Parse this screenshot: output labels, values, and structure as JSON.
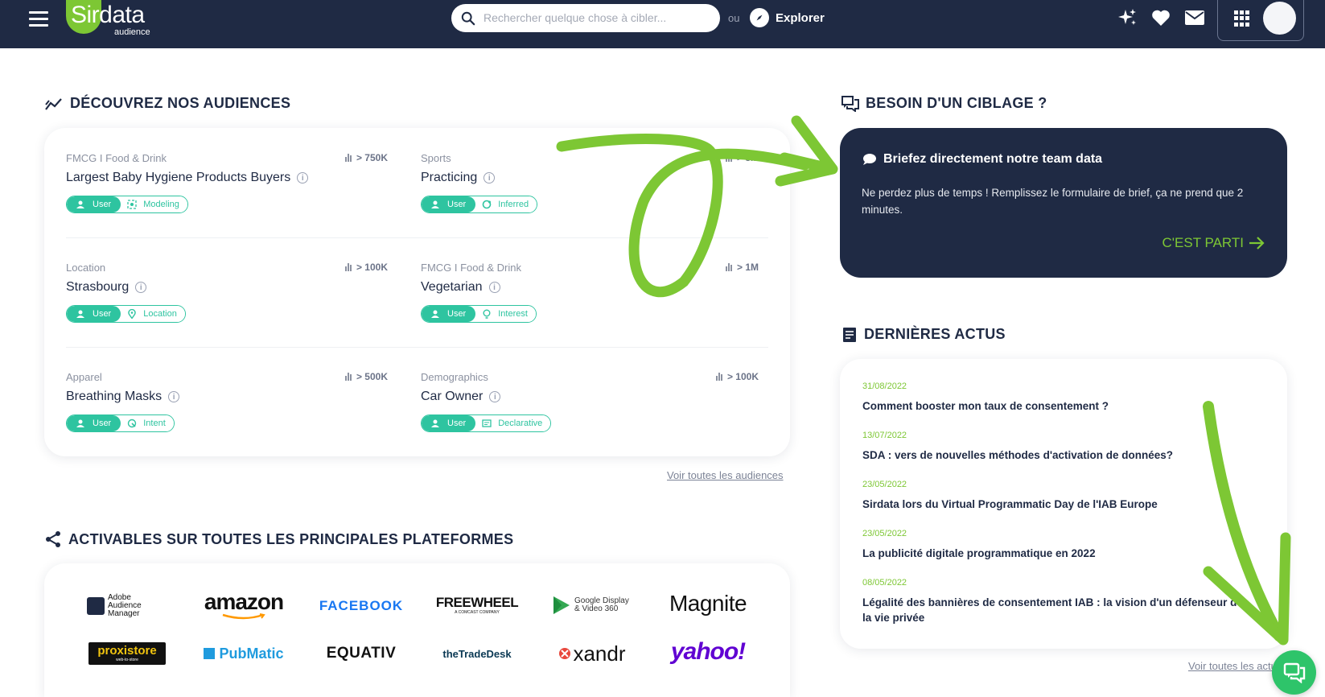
{
  "header": {
    "logo_text": "Sirdata",
    "logo_sub": "audience",
    "search_placeholder": "Rechercher quelque chose à cibler...",
    "or_label": "ou",
    "explorer_label": "Explorer"
  },
  "audiences": {
    "title": "DÉCOUVREZ NOS AUDIENCES",
    "items": [
      {
        "category": "FMCG I Food & Drink",
        "size": "> 750K",
        "name": "Largest Baby Hygiene Products Buyers",
        "user": "User",
        "kind": "Modeling",
        "kind_icon": "modeling-icon"
      },
      {
        "category": "Sports",
        "size": "> 5M",
        "name": "Practicing",
        "user": "User",
        "kind": "Inferred",
        "kind_icon": "inferred-icon"
      },
      {
        "category": "Location",
        "size": "> 100K",
        "name": "Strasbourg",
        "user": "User",
        "kind": "Location",
        "kind_icon": "location-pin-icon"
      },
      {
        "category": "FMCG I Food & Drink",
        "size": "> 1M",
        "name": "Vegetarian",
        "user": "User",
        "kind": "Interest",
        "kind_icon": "lightbulb-icon"
      },
      {
        "category": "Apparel",
        "size": "> 500K",
        "name": "Breathing Masks",
        "user": "User",
        "kind": "Intent",
        "kind_icon": "intent-icon"
      },
      {
        "category": "Demographics",
        "size": "> 100K",
        "name": "Car Owner",
        "user": "User",
        "kind": "Declarative",
        "kind_icon": "declarative-icon"
      }
    ],
    "see_all": "Voir toutes les audiences"
  },
  "platforms": {
    "title": "ACTIVABLES SUR TOUTES LES PRINCIPALES PLATEFORMES",
    "logos": [
      "Adobe Audience Manager",
      "amazon",
      "FACEBOOK",
      "FREEWHEEL",
      "Google Display & Video 360",
      "Magnite",
      "proxistore",
      "PubMatic",
      "EQUATIV",
      "theTradeDesk",
      "xandr",
      "yahoo!"
    ],
    "freewheel_sub": "A COMCAST COMPANY",
    "proxistore_sub": "web-to-store"
  },
  "brief": {
    "section_title": "BESOIN D'UN CIBLAGE ?",
    "card_title": "Briefez directement notre team data",
    "body": "Ne perdez plus de temps ! Remplissez le formulaire de brief, ça ne prend que 2 minutes.",
    "cta": "C'EST PARTI"
  },
  "news": {
    "title": "DERNIÈRES ACTUS",
    "items": [
      {
        "date": "31/08/2022",
        "title": "Comment booster mon taux de consentement ?"
      },
      {
        "date": "13/07/2022",
        "title": "SDA : vers de nouvelles méthodes d'activation de données?"
      },
      {
        "date": "23/05/2022",
        "title": "Sirdata lors du Virtual Programmatic Day de l'IAB Europe"
      },
      {
        "date": "23/05/2022",
        "title": "La publicité digitale programmatique en 2022"
      },
      {
        "date": "08/05/2022",
        "title": "Légalité des bannières de consentement IAB : la vision d'un défenseur de la vie privée"
      }
    ],
    "see_all": "Voir toutes les actus"
  },
  "colors": {
    "navy": "#1f2a44",
    "teal": "#2ec4a0",
    "green": "#7dc734",
    "chat": "#2ec46a"
  }
}
